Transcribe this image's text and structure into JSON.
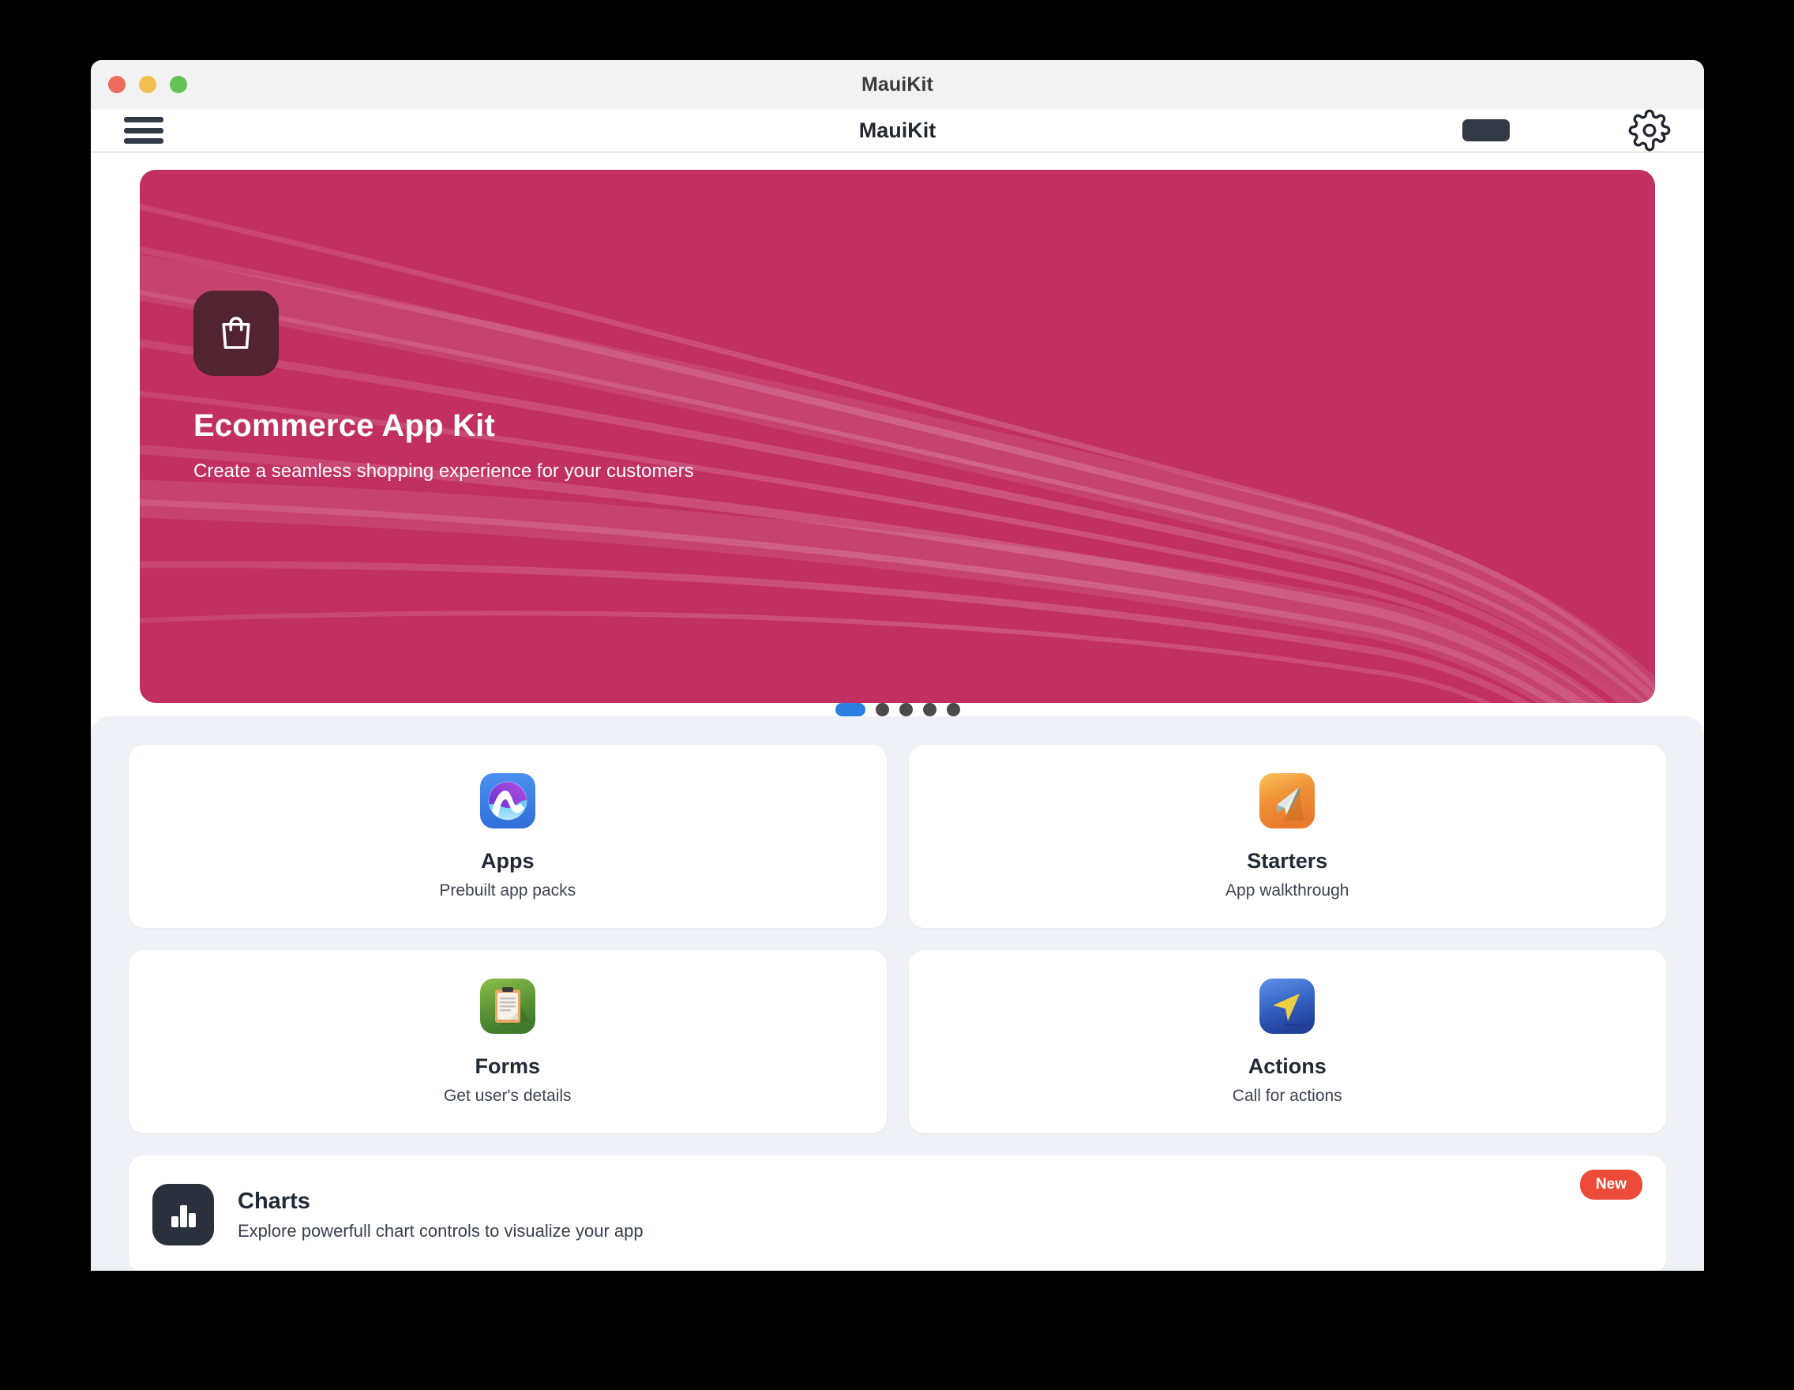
{
  "window": {
    "title": "MauiKit",
    "traffic_lights": [
      "close",
      "minimize",
      "maximize"
    ]
  },
  "toolbar": {
    "menu_icon": "hamburger-menu-icon",
    "title": "MauiKit",
    "theme_chip": "theme-toggle-chip",
    "settings_icon": "gear-icon"
  },
  "hero": {
    "icon": "shopping-bag-icon",
    "title": "Ecommerce App Kit",
    "subtitle": "Create a seamless shopping experience for your customers",
    "background_color": "#c13061",
    "icon_background_color": "#522330"
  },
  "pager": {
    "total": 5,
    "active_index": 0,
    "active_color": "#2b7fe0",
    "inactive_color": "#4a4a4a"
  },
  "tiles": [
    {
      "title": "Apps",
      "subtitle": "Prebuilt app packs",
      "icon": "maui-logo-icon",
      "icon_color": "#3b82e8"
    },
    {
      "title": "Starters",
      "subtitle": "App walkthrough",
      "icon": "paper-plane-icon",
      "icon_color": "#f0962f"
    },
    {
      "title": "Forms",
      "subtitle": "Get user's details",
      "icon": "clipboard-icon",
      "icon_color": "#4f8a2e"
    },
    {
      "title": "Actions",
      "subtitle": "Call for actions",
      "icon": "cursor-arrow-icon",
      "icon_color": "#2f5fc4"
    }
  ],
  "wide_row": {
    "title": "Charts",
    "subtitle": "Explore powerfull chart controls to visualize your app",
    "icon": "bar-chart-icon",
    "badge": "New",
    "badge_color": "#eb4b38"
  }
}
